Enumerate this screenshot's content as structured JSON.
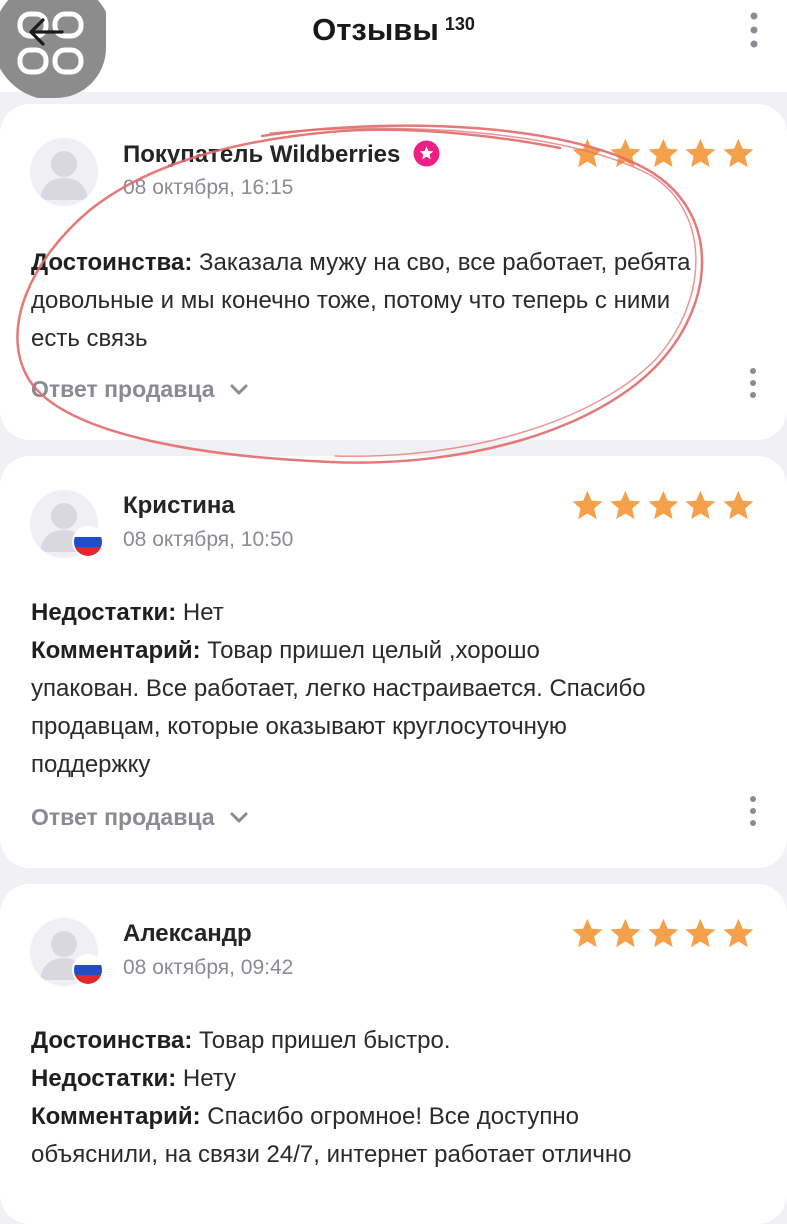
{
  "header": {
    "title": "Отзывы",
    "count": "130",
    "back_icon": "arrow-left-icon",
    "menu_icon": "more-vertical-icon"
  },
  "reviews": [
    {
      "author": "Покупатель Wildberries",
      "date": "08 октября, 16:15",
      "rating": 5,
      "verified": true,
      "lines": [
        {
          "label": "Достоинства:",
          "value": "Заказала мужу на сво, все работает, ребята довольные и мы конечно тоже, потому что теперь с ними есть связь"
        }
      ],
      "seller_reply": "Ответ продавца"
    },
    {
      "author": "Кристина",
      "date": "08 октября, 10:50",
      "rating": 5,
      "flag": "ru",
      "lines": [
        {
          "label": "Недостатки:",
          "value": "Нет"
        },
        {
          "label": "Комментарий:",
          "value": "Товар пришел целый ,хорошо упакован. Все работает, легко настраивается. Спасибо продавцам, которые оказывают круглосуточную поддержку"
        }
      ],
      "seller_reply": "Ответ продавца"
    },
    {
      "author": "Александр",
      "date": "08 октября, 09:42",
      "rating": 5,
      "flag": "ru",
      "lines": [
        {
          "label": "Достоинства:",
          "value": "Товар пришел быстро."
        },
        {
          "label": "Недостатки:",
          "value": "Нету"
        },
        {
          "label": "Комментарий:",
          "value": "Спасибо огромное! Все доступно объяснили, на связи 24/7, интернет работает отлично"
        }
      ]
    }
  ],
  "colors": {
    "star": "#f5a04a",
    "verified_badge": "#ef1f84",
    "annotation": "#e26a6a",
    "muted_text": "#8b8b95"
  }
}
